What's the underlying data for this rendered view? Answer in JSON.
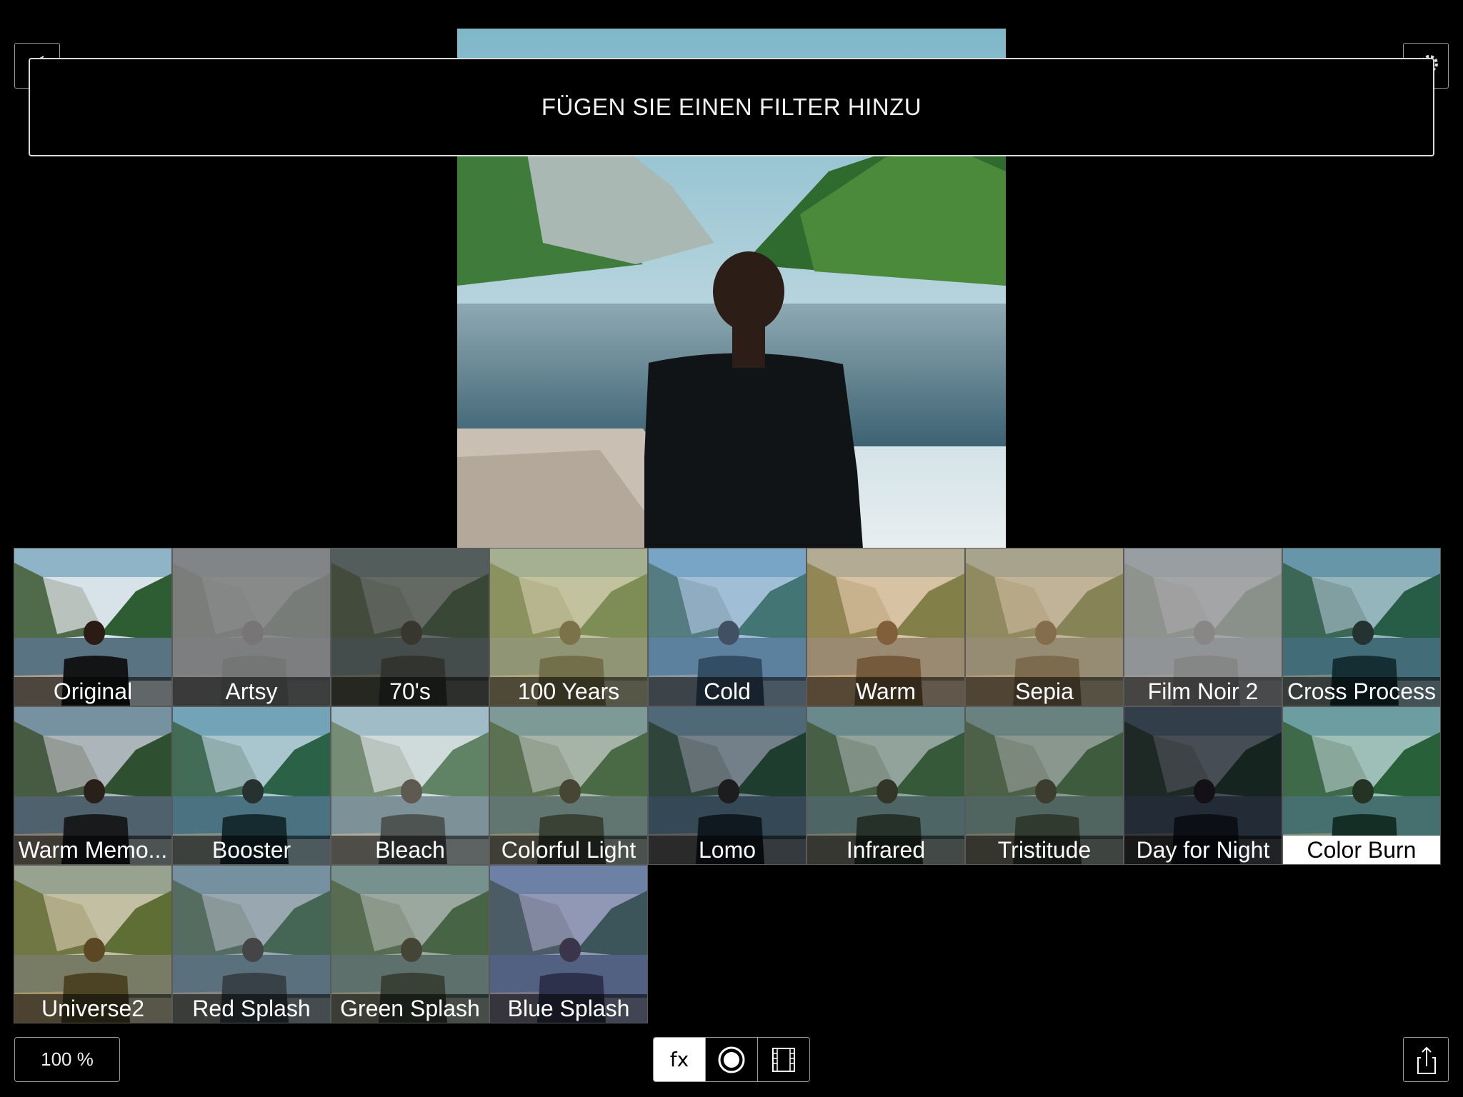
{
  "banner": {
    "text": "FÜGEN SIE EINEN FILTER HINZU"
  },
  "filters": [
    {
      "label": "Original",
      "tint": "#2f6f8f",
      "opacity": 0.0
    },
    {
      "label": "Artsy",
      "tint": "#808080",
      "opacity": 0.9
    },
    {
      "label": "70's",
      "tint": "#3d4038",
      "opacity": 0.75
    },
    {
      "label": "100 Years",
      "tint": "#b4ab6e",
      "opacity": 0.6
    },
    {
      "label": "Cold",
      "tint": "#5d93c4",
      "opacity": 0.45
    },
    {
      "label": "Warm",
      "tint": "#d7a160",
      "opacity": 0.5
    },
    {
      "label": "Sepia",
      "tint": "#b69a6b",
      "opacity": 0.65
    },
    {
      "label": "Film Noir 2",
      "tint": "#9a9a9a",
      "opacity": 0.85
    },
    {
      "label": "Cross Process",
      "tint": "#1a5f69",
      "opacity": 0.35
    },
    {
      "label": "Warm Memo...",
      "tint": "#2a2a2a",
      "opacity": 0.25
    },
    {
      "label": "Booster",
      "tint": "#1f6e7e",
      "opacity": 0.25
    },
    {
      "label": "Bleach",
      "tint": "#c0ccc4",
      "opacity": 0.35
    },
    {
      "label": "Colorful Light",
      "tint": "#6b7b5c",
      "opacity": 0.45
    },
    {
      "label": "Lomo",
      "tint": "#0f1e2a",
      "opacity": 0.5
    },
    {
      "label": "Infrared",
      "tint": "#3f5540",
      "opacity": 0.45
    },
    {
      "label": "Tristitude",
      "tint": "#4b5a46",
      "opacity": 0.55
    },
    {
      "label": "Day for Night",
      "tint": "#0a0d16",
      "opacity": 0.7
    },
    {
      "label": "Color Burn",
      "tint": "#1c6a48",
      "opacity": 0.3
    },
    {
      "label": "Universe2",
      "tint": "#a68a39",
      "opacity": 0.4
    },
    {
      "label": "Red Splash",
      "tint": "#5b6e78",
      "opacity": 0.5
    },
    {
      "label": "Green Splash",
      "tint": "#5f6e55",
      "opacity": 0.5
    },
    {
      "label": "Blue Splash",
      "tint": "#4a4e82",
      "opacity": 0.5
    }
  ],
  "selected_filter": "Color Burn",
  "toolbar": {
    "zoom_label": "100 %",
    "fx_label": "fx"
  },
  "colors": {
    "selection_bg": "#ffffff",
    "border": "#9a9a9a"
  },
  "icons": {
    "back": "back-arrow-icon",
    "settings": "gear-icon",
    "filters": "fx-icon",
    "vignette": "target-circle-icon",
    "frame": "film-frame-icon",
    "share": "share-icon"
  }
}
